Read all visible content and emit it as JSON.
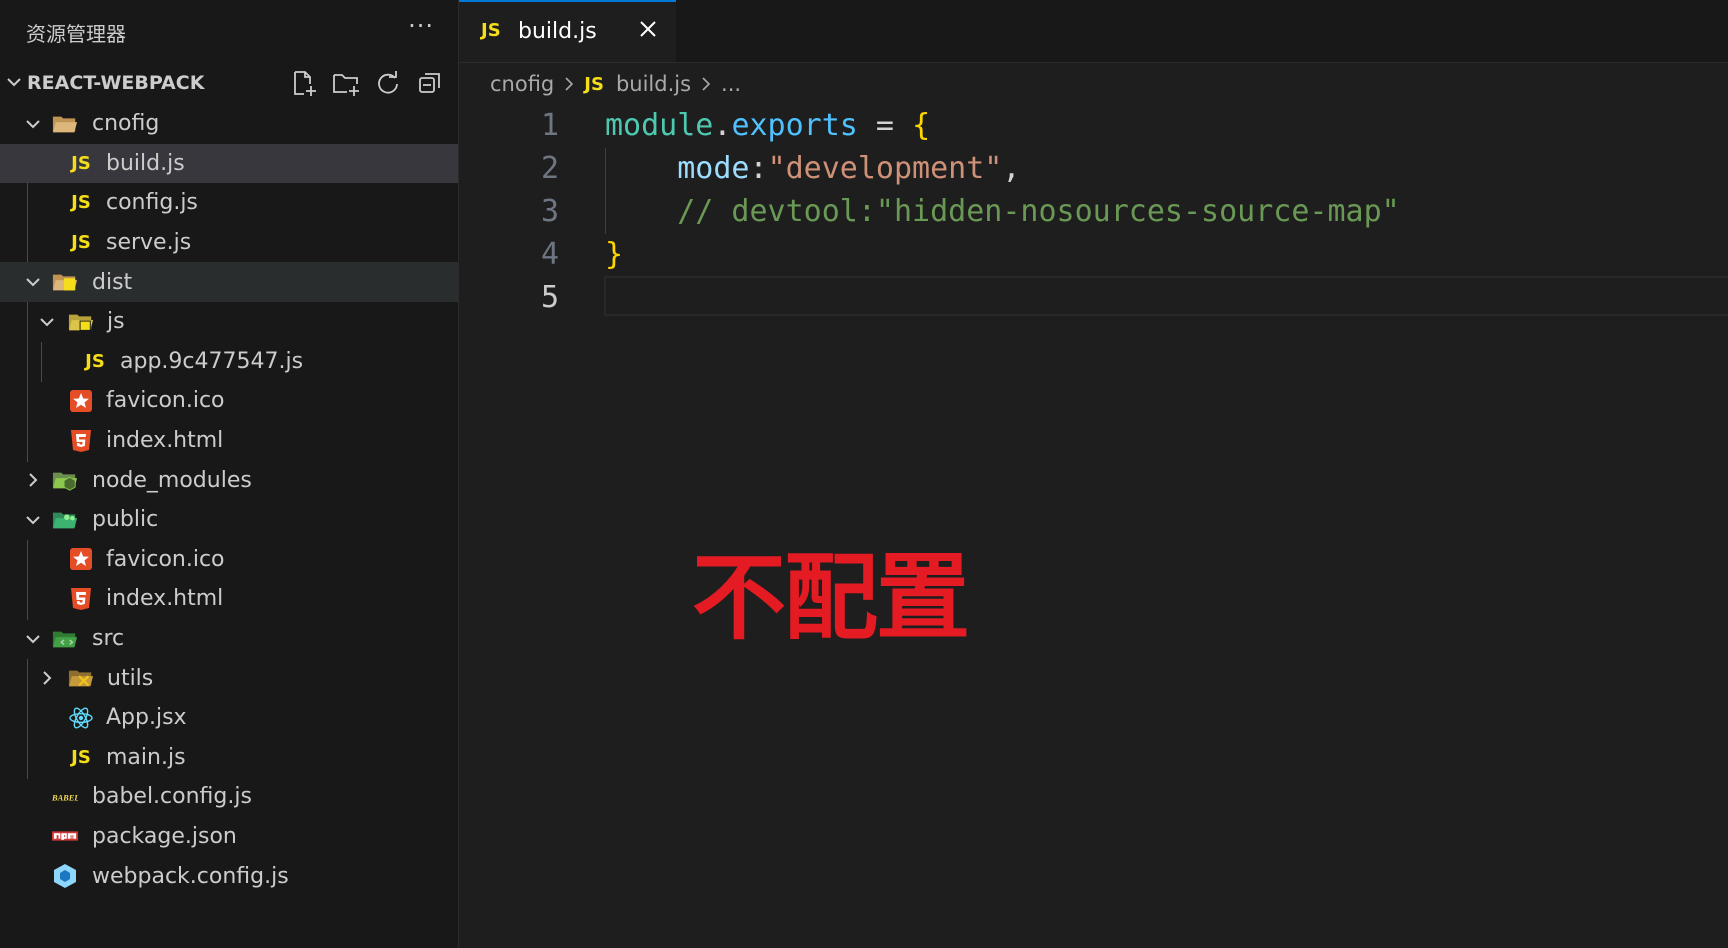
{
  "sidebar": {
    "title": "资源管理器",
    "more_label": "···",
    "project_name": "REACT-WEBPACK",
    "actions": [
      "new-file-icon",
      "new-folder-icon",
      "refresh-icon",
      "collapse-all-icon"
    ],
    "items": [
      {
        "label": "cnofig",
        "type": "folder",
        "expanded": true
      },
      {
        "label": "build.js",
        "type": "js",
        "selected": true
      },
      {
        "label": "config.js",
        "type": "js"
      },
      {
        "label": "serve.js",
        "type": "js"
      },
      {
        "label": "dist",
        "type": "folder",
        "expanded": true
      },
      {
        "label": "js",
        "type": "folder",
        "expanded": true
      },
      {
        "label": "app.9c477547.js",
        "type": "js"
      },
      {
        "label": "favicon.ico",
        "type": "ico"
      },
      {
        "label": "index.html",
        "type": "html"
      },
      {
        "label": "node_modules",
        "type": "folder",
        "expanded": false
      },
      {
        "label": "public",
        "type": "folder",
        "expanded": true
      },
      {
        "label": "favicon.ico",
        "type": "ico"
      },
      {
        "label": "index.html",
        "type": "html"
      },
      {
        "label": "src",
        "type": "folder",
        "expanded": true
      },
      {
        "label": "utils",
        "type": "folder",
        "expanded": false
      },
      {
        "label": "App.jsx",
        "type": "react"
      },
      {
        "label": "main.js",
        "type": "js"
      },
      {
        "label": "babel.config.js",
        "type": "babel"
      },
      {
        "label": "package.json",
        "type": "npm"
      },
      {
        "label": "webpack.config.js",
        "type": "webpack"
      }
    ]
  },
  "tab": {
    "icon_text": "JS",
    "label": "build.js"
  },
  "breadcrumb": {
    "folder": "cnofig",
    "icon_text": "JS",
    "file": "build.js",
    "more": "..."
  },
  "editor": {
    "line_numbers": [
      "1",
      "2",
      "3",
      "4",
      "5"
    ],
    "active_line": "5",
    "line1": {
      "obj": "module",
      "dot": ".",
      "prop": "exports",
      "eq": " = ",
      "brace": "{"
    },
    "line2": {
      "indent": "    ",
      "key": "mode",
      "colon": ":",
      "value": "\"development\"",
      "comma": ","
    },
    "line3": {
      "indent": "    ",
      "comment": "// devtool:\"hidden-nosources-source-map\""
    },
    "line4": {
      "brace": "}"
    }
  },
  "annotation": "不配置",
  "colors": {
    "accent": "#0078d4",
    "js_yellow": "#f5de19",
    "annotation_red": "#e41b23"
  }
}
